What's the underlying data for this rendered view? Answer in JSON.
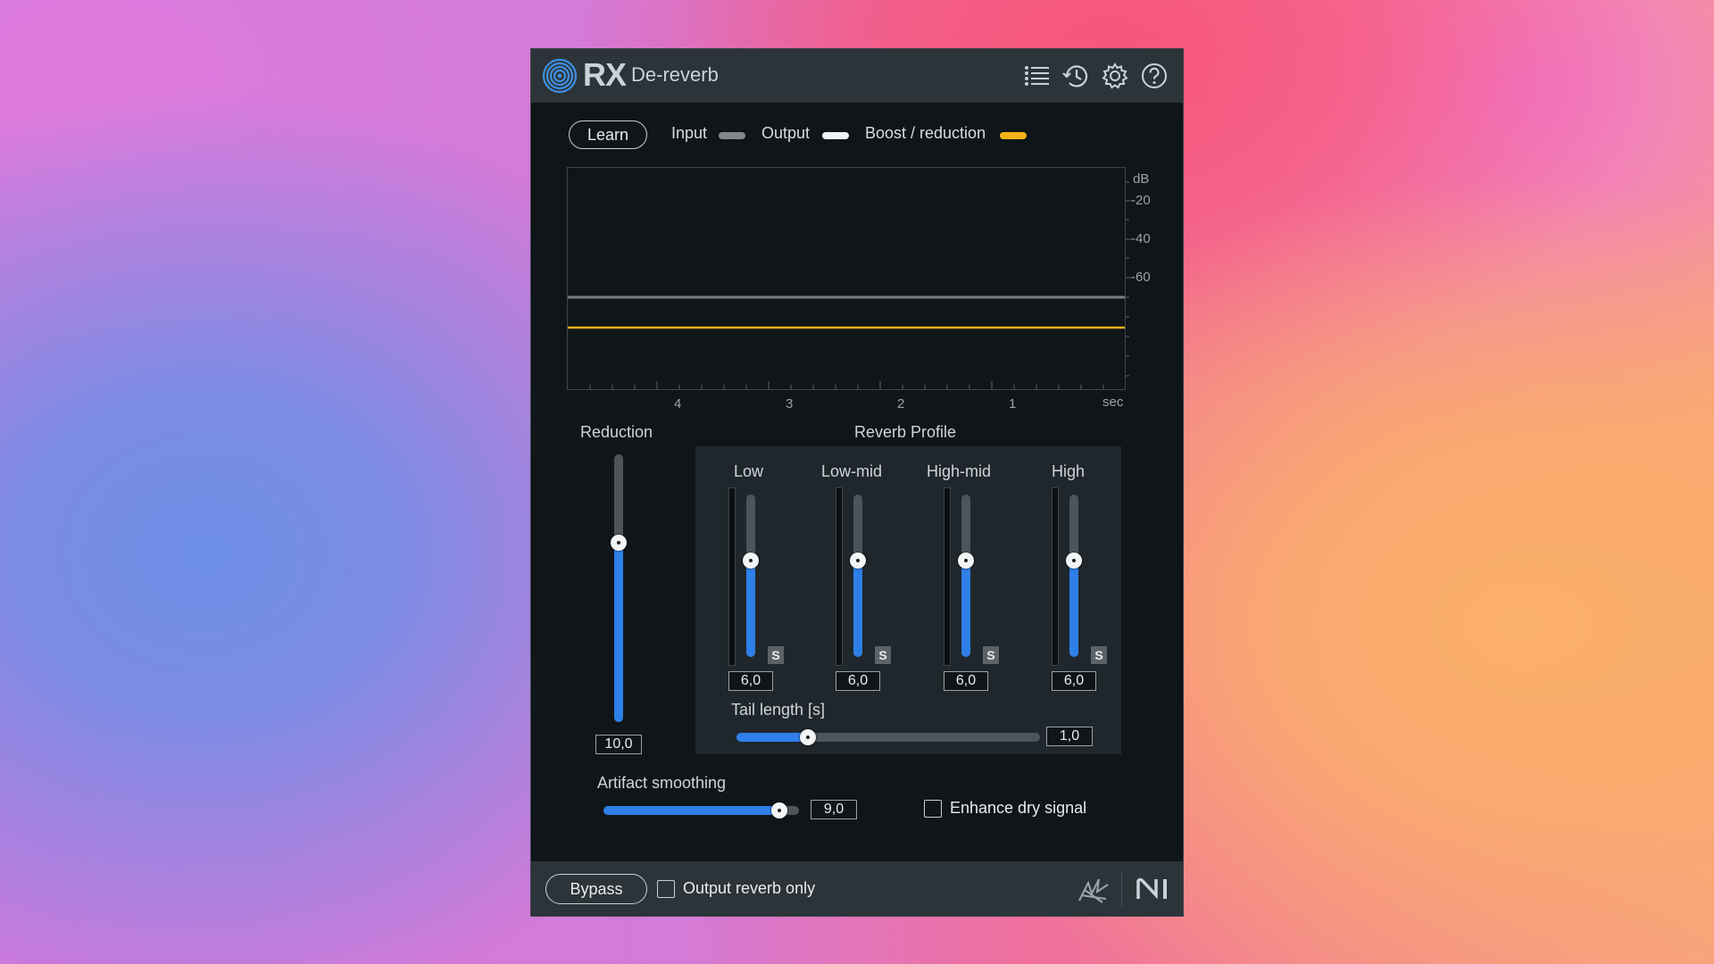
{
  "header": {
    "product": "RX",
    "module": "De-reverb",
    "icons": [
      "list-icon",
      "history-icon",
      "gear-icon",
      "help-icon"
    ]
  },
  "controls": {
    "learn_label": "Learn"
  },
  "legend": {
    "input": "Input",
    "output": "Output",
    "boost": "Boost / reduction",
    "colors": {
      "input": "#80878d",
      "output": "#f2f4f5",
      "boost": "#f3b318"
    }
  },
  "graph": {
    "y_unit": "dB",
    "y_ticks": [
      "-20",
      "-40",
      "-60"
    ],
    "x_ticks": [
      "4",
      "3",
      "2",
      "1"
    ],
    "x_unit": "sec"
  },
  "reduction": {
    "label": "Reduction",
    "value": "10,0",
    "level": 0.66
  },
  "profile": {
    "title": "Reverb Profile",
    "bands": [
      {
        "label": "Low",
        "value": "6,0",
        "solo": "S",
        "level": 0.6
      },
      {
        "label": "Low-mid",
        "value": "6,0",
        "solo": "S",
        "level": 0.6
      },
      {
        "label": "High-mid",
        "value": "6,0",
        "solo": "S",
        "level": 0.6
      },
      {
        "label": "High",
        "value": "6,0",
        "solo": "S",
        "level": 0.6
      }
    ],
    "tail": {
      "label": "Tail length [s]",
      "value": "1,0",
      "level": 0.23
    }
  },
  "artifact": {
    "label": "Artifact smoothing",
    "value": "9,0",
    "level": 0.9
  },
  "enhance": {
    "label": "Enhance dry signal",
    "checked": false
  },
  "footer": {
    "bypass_label": "Bypass",
    "output_reverb_only": "Output reverb only",
    "icons": [
      "izotope-signature-icon",
      "ni-logo-icon"
    ]
  },
  "accent_color": "#2f7fe8"
}
